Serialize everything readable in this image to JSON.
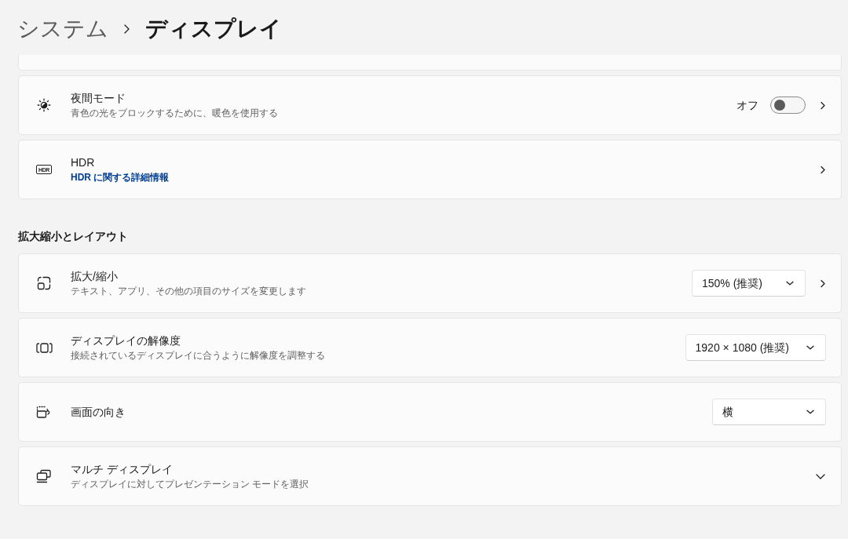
{
  "breadcrumb": [
    {
      "label": "システム",
      "current": false
    },
    {
      "label": "ディスプレイ",
      "current": true
    }
  ],
  "groups": [
    {
      "rows": [
        {
          "kind": "navigation",
          "title": "夜間モード",
          "subtitle": "青色の光をブロックするために、暖色を使用する",
          "toggle": {
            "label": "オフ",
            "on": false
          }
        },
        {
          "kind": "navigation",
          "badge": "HDR",
          "title": "HDR",
          "link": "HDR に関する詳細情報"
        }
      ]
    },
    {
      "heading": "拡大縮小とレイアウト",
      "rows": [
        {
          "kind": "navigation",
          "title": "拡大/縮小",
          "subtitle": "テキスト、アプリ、その他の項目のサイズを変更します",
          "dropdown": {
            "value": "150% (推奨)"
          }
        },
        {
          "kind": "setting",
          "title": "ディスプレイの解像度",
          "subtitle": "接続されているディスプレイに合うように解像度を調整する",
          "dropdown": {
            "value": "1920 × 1080 (推奨)"
          }
        },
        {
          "kind": "setting",
          "title": "画面の向き",
          "dropdown": {
            "value": "横"
          }
        },
        {
          "kind": "expander",
          "title": "マルチ ディスプレイ",
          "subtitle": "ディスプレイに対してプレゼンテーション モードを選択",
          "expanded": false
        }
      ]
    }
  ]
}
